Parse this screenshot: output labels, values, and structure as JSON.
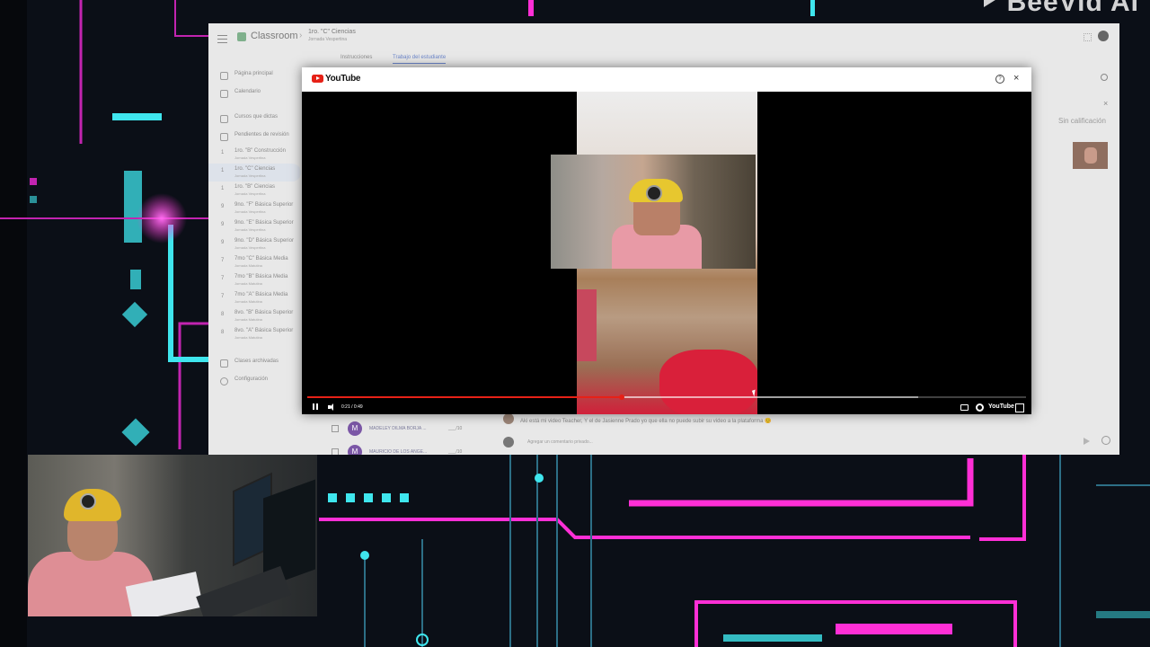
{
  "watermark": {
    "text": "BeeVid AI"
  },
  "classroom": {
    "app_name": "Classroom",
    "breadcrumb_sep": "›",
    "class_name": "1ro. \"C\" Ciencias",
    "class_shift": "Jornada Vespertina",
    "tabs": [
      "Instrucciones",
      "Trabajo del estudiante"
    ],
    "sidebar": [
      {
        "icon": "home-icon",
        "label": "Página principal"
      },
      {
        "icon": "calendar-icon",
        "label": "Calendario"
      },
      {
        "icon": "people-icon",
        "label": "Cursos que dictas"
      },
      {
        "icon": "review-icon",
        "label": "Pendientes de revisión"
      },
      {
        "initial": "1",
        "label": "1ro. \"B\" Construcción",
        "sub": "Jornada Vespertina"
      },
      {
        "initial": "1",
        "label": "1ro. \"C\" Ciencias",
        "sub": "Jornada Vespertina"
      },
      {
        "initial": "1",
        "label": "1ro. \"B\" Ciencias",
        "sub": "Jornada Vespertina"
      },
      {
        "initial": "9",
        "label": "9no. \"F\" Básica Superior",
        "sub": "Jornada Vespertina"
      },
      {
        "initial": "9",
        "label": "9no. \"E\" Básica Superior",
        "sub": "Jornada Vespertina"
      },
      {
        "initial": "9",
        "label": "9no. \"D\" Básica Superior",
        "sub": "Jornada Vespertina"
      },
      {
        "initial": "7",
        "label": "7mo \"C\" Básica Media",
        "sub": "Jornada Matutina"
      },
      {
        "initial": "7",
        "label": "7mo \"B\" Básica Media",
        "sub": "Jornada Matutina"
      },
      {
        "initial": "7",
        "label": "7mo \"A\" Básica Media",
        "sub": "Jornada Matutina"
      },
      {
        "initial": "8",
        "label": "8vo. \"B\" Básica Superior",
        "sub": "Jornada Matutina"
      },
      {
        "initial": "8",
        "label": "8vo. \"A\" Básica Superior",
        "sub": "Jornada Matutina"
      },
      {
        "icon": "archive-icon",
        "label": "Clases archivadas"
      },
      {
        "icon": "settings-icon",
        "label": "Configuración"
      }
    ],
    "grade_status": "Sin calificación",
    "students": [
      {
        "initial": "M",
        "name": "MADELEY DILMA BORJA ...",
        "grade": "___/10"
      },
      {
        "initial": "M",
        "name": "MAURICIO DE LOS ANGE...",
        "grade": "___/10"
      }
    ],
    "comment": "Aki está mi video Teacher, Y el de Jasienne Prado yo que ella no puede subir su video a la plataforma 😊",
    "comment_placeholder": "Agregar un comentario privado..."
  },
  "youtube": {
    "logo_text": "YouTube",
    "help_label": "?",
    "close_label": "×",
    "time": "0:21 / 0:49",
    "progress": 0.438,
    "buffered": 0.85,
    "brand_label": "YouTube"
  },
  "colors": {
    "youtube_red": "#e62117",
    "classroom_accent": "#6b85c9",
    "neon_pink": "#ff2fd6",
    "neon_cyan": "#3fe6ee"
  }
}
